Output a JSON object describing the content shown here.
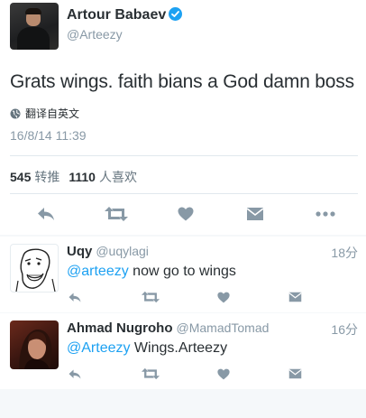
{
  "tweet": {
    "author_name": "Artour Babaev",
    "author_handle": "@Arteezy",
    "verified": true,
    "text": "Grats wings. faith bians a God damn boss",
    "translate_label": "翻译自英文",
    "timestamp": "16/8/14 11:39",
    "retweet_count": "545",
    "retweet_label": "转推",
    "like_count": "1110",
    "like_label": "人喜欢"
  },
  "icons": {
    "reply": "reply-icon",
    "retweet": "retweet-icon",
    "like": "heart-icon",
    "dm": "envelope-icon",
    "more": "more-icon"
  },
  "colors": {
    "link": "#1da1f2",
    "icon_gray": "#8899a6",
    "divider": "#e1e8ed"
  },
  "replies": [
    {
      "name": "Uqy",
      "handle": "@uqylagi",
      "time": "18分",
      "mention": "@arteezy",
      "text": " now go to wings"
    },
    {
      "name": "Ahmad Nugroho",
      "handle": "@MamadTomad",
      "time": "16分",
      "mention": "@Arteezy",
      "text": " Wings.Arteezy"
    }
  ]
}
